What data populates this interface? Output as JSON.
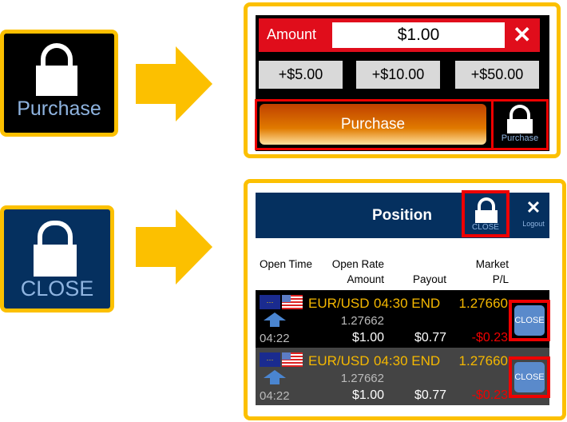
{
  "legend": {
    "purchase_label": "Purchase",
    "close_label": "CLOSE"
  },
  "purchase_panel": {
    "amount_label": "Amount",
    "amount_value": "$1.00",
    "clear_icon": "x-icon",
    "increments": [
      "+$5.00",
      "+$10.00",
      "+$50.00"
    ],
    "purchase_button": "Purchase",
    "purchase_icon_label": "Purchase"
  },
  "position_panel": {
    "title": "Position",
    "close_label": "CLOSE",
    "logout_label": "Logout",
    "headers": {
      "open_time": "Open Time",
      "open_rate": "Open Rate",
      "amount": "Amount",
      "payout": "Payout",
      "market": "Market",
      "pl": "P/L"
    },
    "rows": [
      {
        "pair": "EUR/USD",
        "expiry": "04:30 END",
        "market": "1.27660",
        "open_rate": "1.27662",
        "open_time": "04:22",
        "amount": "$1.00",
        "payout": "$0.77",
        "pl": "-$0.23",
        "close": "CLOSE"
      },
      {
        "pair": "EUR/USD",
        "expiry": "04:30 END",
        "market": "1.27660",
        "open_rate": "1.27662",
        "open_time": "04:22",
        "amount": "$1.00",
        "payout": "$0.77",
        "pl": "-$0.23",
        "close": "CLOSE"
      }
    ]
  },
  "colors": {
    "highlight": "#fcc000",
    "red": "#e00d1b",
    "navy": "#05305f",
    "gold": "#f5b800"
  }
}
